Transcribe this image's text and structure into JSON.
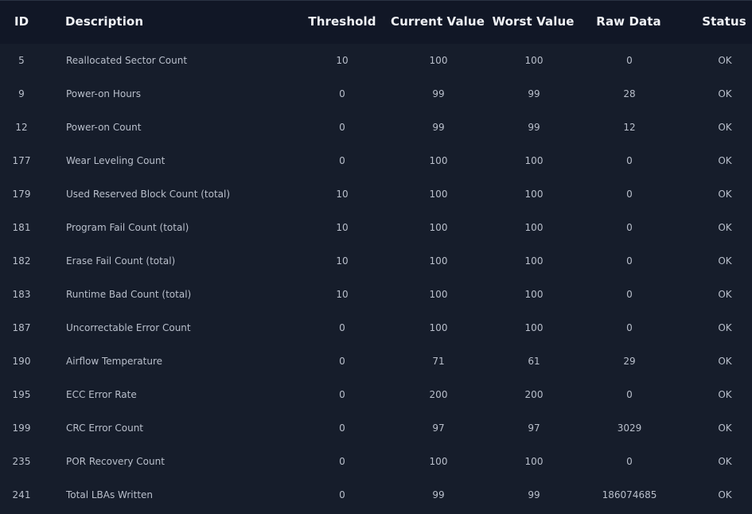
{
  "columns": {
    "id": "ID",
    "description": "Description",
    "threshold": "Threshold",
    "current": "Current Value",
    "worst": "Worst Value",
    "raw": "Raw Data",
    "status": "Status"
  },
  "rows": [
    {
      "id": "5",
      "description": "Reallocated Sector Count",
      "threshold": "10",
      "current": "100",
      "worst": "100",
      "raw": "0",
      "status": "OK"
    },
    {
      "id": "9",
      "description": "Power-on Hours",
      "threshold": "0",
      "current": "99",
      "worst": "99",
      "raw": "28",
      "status": "OK"
    },
    {
      "id": "12",
      "description": "Power-on Count",
      "threshold": "0",
      "current": "99",
      "worst": "99",
      "raw": "12",
      "status": "OK"
    },
    {
      "id": "177",
      "description": "Wear Leveling Count",
      "threshold": "0",
      "current": "100",
      "worst": "100",
      "raw": "0",
      "status": "OK"
    },
    {
      "id": "179",
      "description": "Used Reserved Block Count (total)",
      "threshold": "10",
      "current": "100",
      "worst": "100",
      "raw": "0",
      "status": "OK"
    },
    {
      "id": "181",
      "description": "Program Fail Count (total)",
      "threshold": "10",
      "current": "100",
      "worst": "100",
      "raw": "0",
      "status": "OK"
    },
    {
      "id": "182",
      "description": "Erase Fail Count (total)",
      "threshold": "10",
      "current": "100",
      "worst": "100",
      "raw": "0",
      "status": "OK"
    },
    {
      "id": "183",
      "description": "Runtime Bad Count (total)",
      "threshold": "10",
      "current": "100",
      "worst": "100",
      "raw": "0",
      "status": "OK"
    },
    {
      "id": "187",
      "description": "Uncorrectable Error Count",
      "threshold": "0",
      "current": "100",
      "worst": "100",
      "raw": "0",
      "status": "OK"
    },
    {
      "id": "190",
      "description": "Airflow Temperature",
      "threshold": "0",
      "current": "71",
      "worst": "61",
      "raw": "29",
      "status": "OK"
    },
    {
      "id": "195",
      "description": "ECC Error Rate",
      "threshold": "0",
      "current": "200",
      "worst": "200",
      "raw": "0",
      "status": "OK"
    },
    {
      "id": "199",
      "description": "CRC Error Count",
      "threshold": "0",
      "current": "97",
      "worst": "97",
      "raw": "3029",
      "status": "OK"
    },
    {
      "id": "235",
      "description": "POR Recovery Count",
      "threshold": "0",
      "current": "100",
      "worst": "100",
      "raw": "0",
      "status": "OK"
    },
    {
      "id": "241",
      "description": "Total LBAs Written",
      "threshold": "0",
      "current": "99",
      "worst": "99",
      "raw": "186074685",
      "status": "OK"
    }
  ]
}
